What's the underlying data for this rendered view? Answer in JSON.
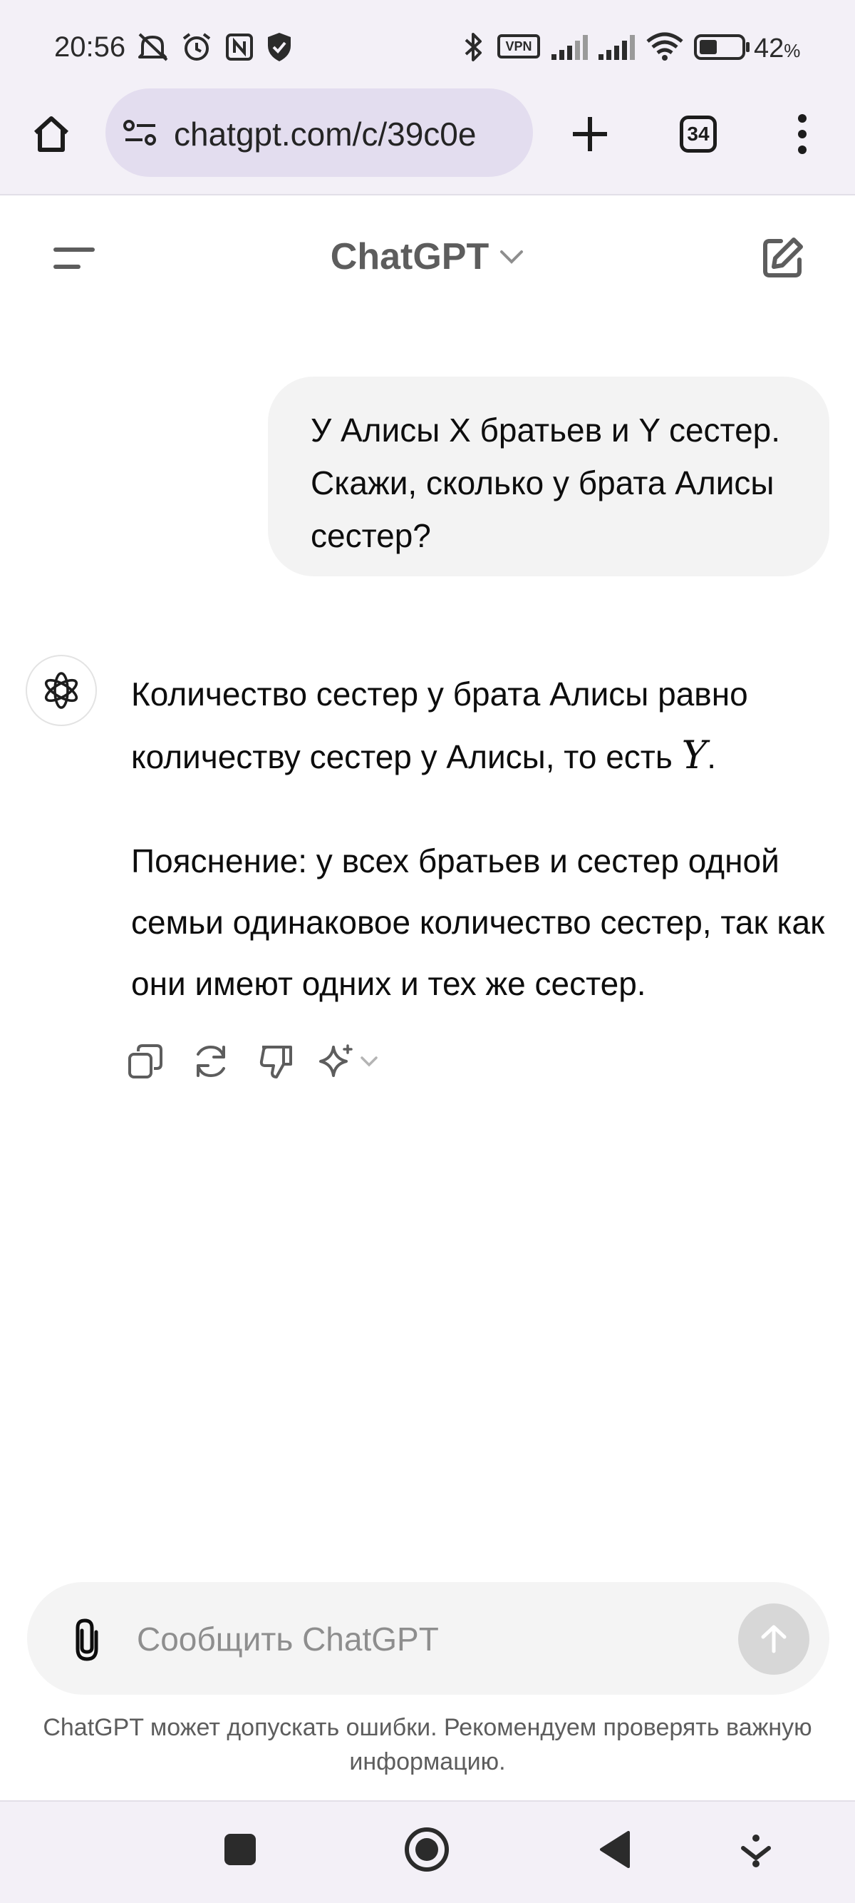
{
  "status_bar": {
    "time": "20:56",
    "vpn_label": "VPN",
    "battery_percent": "42",
    "battery_unit": "%",
    "battery_level": 0.42,
    "icons": [
      "mute-icon",
      "alarm-icon",
      "nfc-icon",
      "shield-icon",
      "bluetooth-icon",
      "vpn-icon",
      "signal-icon",
      "signal-icon",
      "wifi-icon",
      "battery-icon"
    ]
  },
  "browser": {
    "url": "chatgpt.com/c/39c0e",
    "tab_count": "34"
  },
  "app_header": {
    "title": "ChatGPT"
  },
  "conversation": {
    "user_message": "У Алисы X братьев и Y сестер. Скажи, сколько у брата Алисы сестер?",
    "assistant_paragraph_1": "Количество сестер у брата Алисы равно количеству сестер у Алисы, то есть",
    "assistant_math": "Y",
    "assistant_period": ".",
    "assistant_paragraph_2": "Пояснение: у всех братьев и сестер одной семьи одинаковое количество сестер, так как они имеют одних и тех же сестер."
  },
  "composer": {
    "placeholder": "Сообщить ChatGPT",
    "disclaimer": "ChatGPT может допускать ошибки. Рекомендуем проверять важную информацию."
  },
  "colors": {
    "chrome_bg": "#f3f0f7",
    "url_pill": "#e3ddef",
    "user_bubble": "#f3f3f3",
    "send_disabled": "#d7d7d7"
  }
}
